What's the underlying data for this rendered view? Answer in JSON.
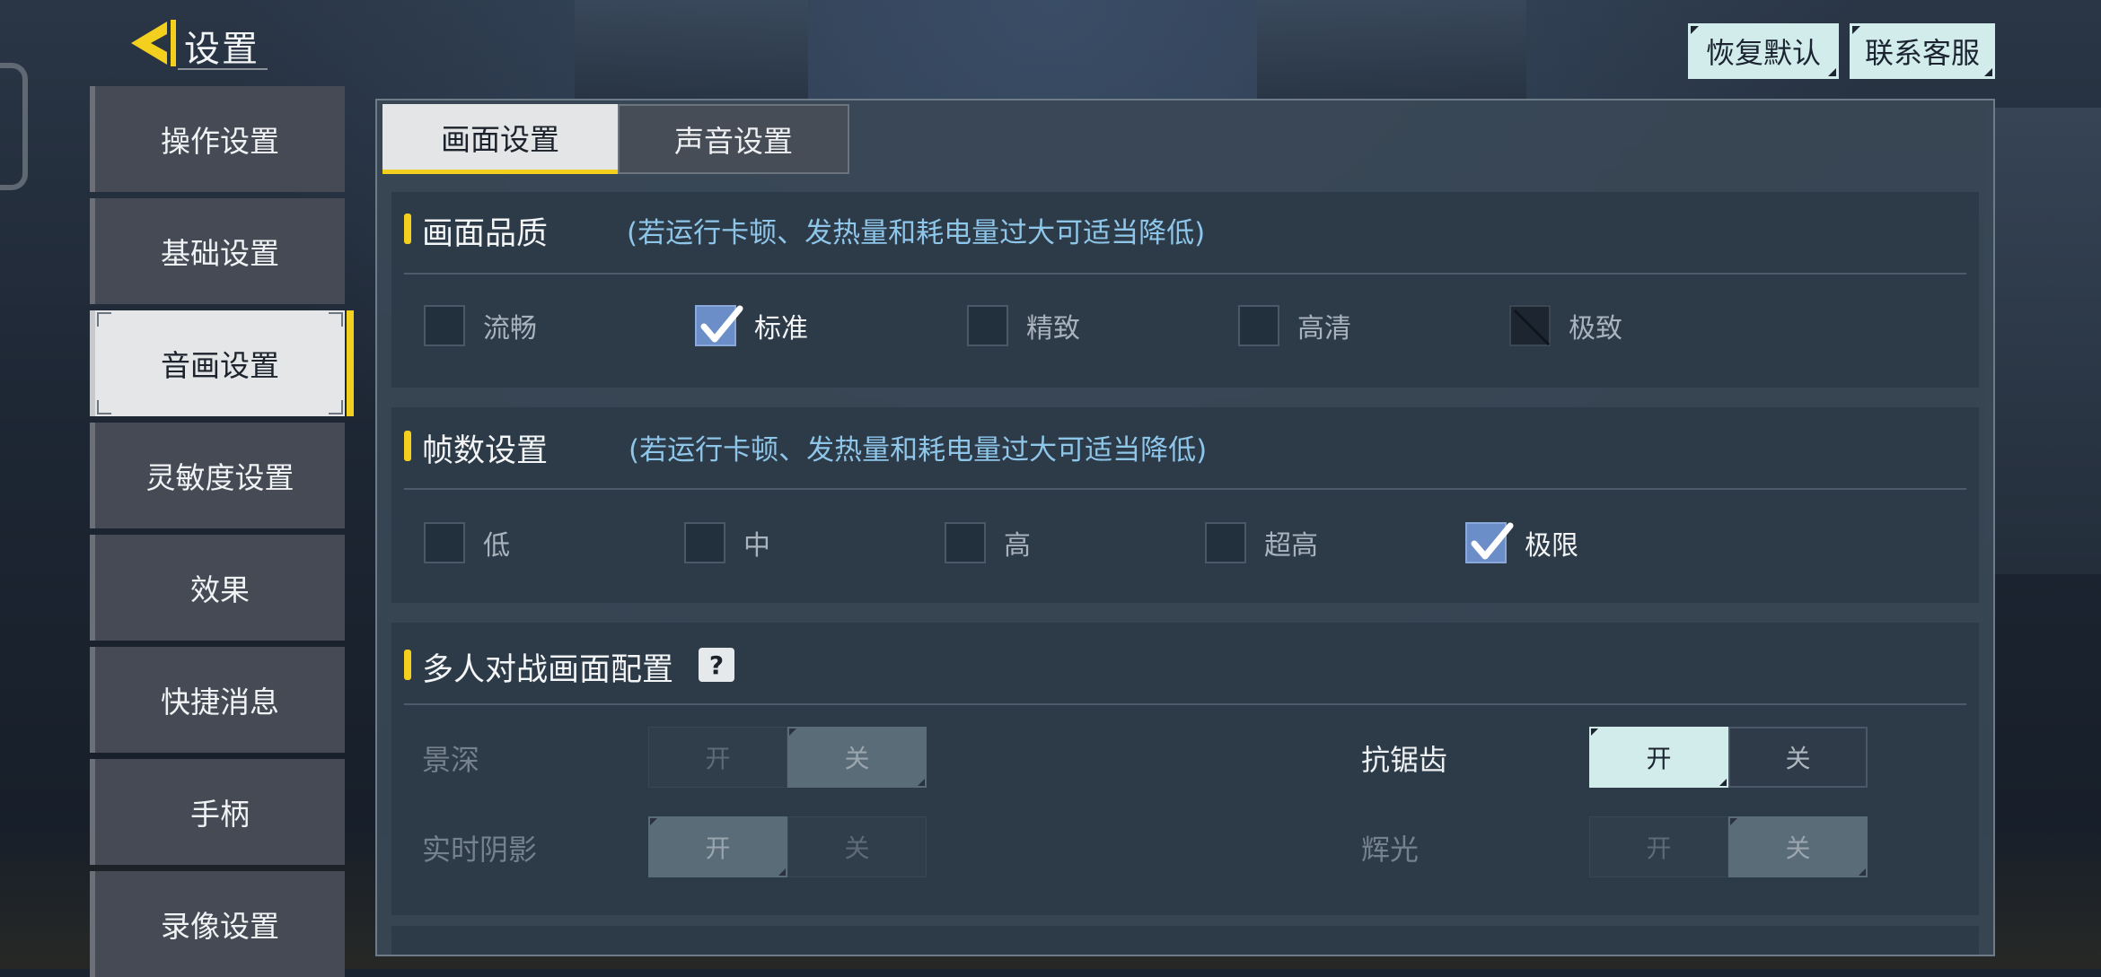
{
  "header": {
    "title": "设置",
    "restore_default": "恢复默认",
    "contact_support": "联系客服"
  },
  "sidebar": {
    "items": [
      {
        "label": "操作设置"
      },
      {
        "label": "基础设置"
      },
      {
        "label": "音画设置",
        "active": true
      },
      {
        "label": "灵敏度设置"
      },
      {
        "label": "效果"
      },
      {
        "label": "快捷消息"
      },
      {
        "label": "手柄"
      },
      {
        "label": "录像设置"
      }
    ]
  },
  "tabs": [
    {
      "label": "画面设置",
      "active": true
    },
    {
      "label": "声音设置",
      "active": false
    }
  ],
  "quality": {
    "title": "画面品质",
    "hint": "(若运行卡顿、发热量和耗电量过大可适当降低)",
    "options": [
      {
        "label": "流畅",
        "state": "unchecked"
      },
      {
        "label": "标准",
        "state": "checked"
      },
      {
        "label": "精致",
        "state": "unchecked"
      },
      {
        "label": "高清",
        "state": "unchecked"
      },
      {
        "label": "极致",
        "state": "disabled"
      }
    ]
  },
  "framerate": {
    "title": "帧数设置",
    "hint": "(若运行卡顿、发热量和耗电量过大可适当降低)",
    "options": [
      {
        "label": "低",
        "state": "unchecked"
      },
      {
        "label": "中",
        "state": "unchecked"
      },
      {
        "label": "高",
        "state": "unchecked"
      },
      {
        "label": "超高",
        "state": "unchecked"
      },
      {
        "label": "极限",
        "state": "checked"
      }
    ]
  },
  "multiplayer": {
    "title": "多人对战画面配置",
    "help_glyph": "?",
    "rows": {
      "depth_of_field": {
        "label": "景深",
        "on": "开",
        "off": "关",
        "value": "关",
        "enabled": false
      },
      "anti_aliasing": {
        "label": "抗锯齿",
        "on": "开",
        "off": "关",
        "value": "开",
        "enabled": true
      },
      "realtime_shadow": {
        "label": "实时阴影",
        "on": "开",
        "off": "关",
        "value": "开",
        "enabled": false
      },
      "bloom": {
        "label": "辉光",
        "on": "开",
        "off": "关",
        "value": "关",
        "enabled": false
      }
    }
  },
  "colors": {
    "accent_yellow": "#f3cf1e",
    "button_cyan": "#d2ecec",
    "check_blue": "#6c8ec8",
    "hint_blue": "#8ec6ea"
  }
}
